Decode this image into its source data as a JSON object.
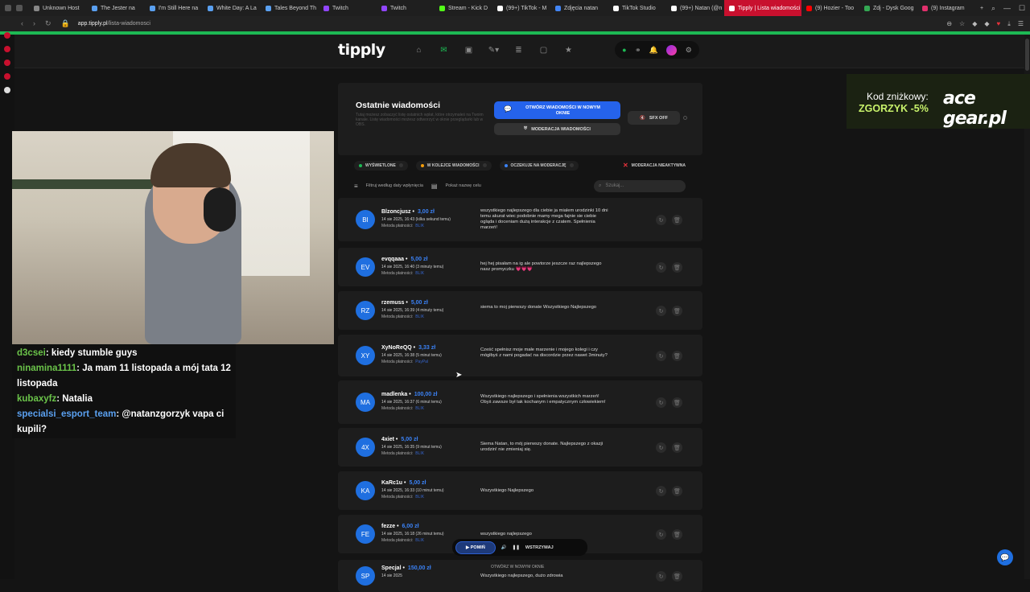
{
  "browser": {
    "tabs": [
      {
        "label": "Unknown Host",
        "color": "#888"
      },
      {
        "label": "The Jester na",
        "color": "#5aa0f0"
      },
      {
        "label": "I'm Still Here na",
        "color": "#5aa0f0"
      },
      {
        "label": "White Day: A La",
        "color": "#5aa0f0"
      },
      {
        "label": "Tales Beyond Th",
        "color": "#5aa0f0"
      },
      {
        "label": "Twitch",
        "color": "#9146ff"
      },
      {
        "label": "Twitch",
        "color": "#9146ff"
      },
      {
        "label": "Stream - Kick D",
        "color": "#53fc18"
      },
      {
        "label": "(99+) TikTok - M",
        "color": "#ffffff"
      },
      {
        "label": "Zdjęcia natan",
        "color": "#4285f4"
      },
      {
        "label": "TikTok Studio",
        "color": "#ffffff"
      },
      {
        "label": "(99+) Natan (@n",
        "color": "#ffffff"
      }
    ],
    "active_tab": "Tipply | Lista wiadomości",
    "tabs_after": [
      {
        "label": "(9) Hozier - Too",
        "color": "#ff0000"
      },
      {
        "label": "Zdj - Dysk Goog",
        "color": "#34a853"
      },
      {
        "label": "(9) Instagram",
        "color": "#e1306c"
      }
    ],
    "url_host": "app.tipply.pl",
    "url_path": "/lista-wiadomosci"
  },
  "header": {
    "logo": "tipply"
  },
  "panel": {
    "title": "Ostatnie wiadomości",
    "description": "Tutaj możesz zobaczyć listę ostatnich wpłat, które otrzymałeś na Twoim kanale. Listę wiadomości możesz odtworzyć w oknie przeglądarki lub w OBS.",
    "open_button": "OTWÓRZ WIADOMOŚCI W NOWYM OKNIE",
    "moderation_button": "MODERACJA WIADOMOŚCI",
    "sfx_button": "SFX OFF"
  },
  "filters": {
    "shown": "WYŚWIETLONE",
    "queue": "W KOLEJCE WIADOMOŚCI",
    "moderation": "OCZEKUJE NA MODERACJĘ",
    "mod_inactive": "MODERACJA NIEAKTYWNA"
  },
  "sort": {
    "by_date": "Filtruj według daty wpłynięcia",
    "show_goal": "Pokaż nazwę celu",
    "search_placeholder": "Szukaj..."
  },
  "messages": [
    {
      "initials": "BI",
      "name": "Blzoncjusz",
      "amount": "3,00 zł",
      "date": "14 sie 2025, 16:43 (kilka sekund temu)",
      "method_label": "Metoda płatności:",
      "method": "BLIK",
      "text": "wszystkiego najlepszego dla ciebie ja mialem urodzinki 10 dni temu akurat wiec podobnie mamy mega fajnie sie ciebie ogląda i doceniam dużą interakcje z czatem. Spełnienia marzeń!"
    },
    {
      "initials": "EV",
      "name": "evqqaaa",
      "amount": "5,00 zł",
      "date": "14 sie 2025, 16:40 (3 minuty temu)",
      "method_label": "Metoda płatności:",
      "method": "BLIK",
      "text": "hej hej pisałam na ig ale powtorze jeszcze raz najlepszego nasz promyczku 💗💗💗"
    },
    {
      "initials": "RZ",
      "name": "rzemuss",
      "amount": "5,00 zł",
      "date": "14 sie 2025, 16:39 (4 minuty temu)",
      "method_label": "Metoda płatności:",
      "method": "BLIK",
      "text": "siema to moj pierwszy donate Wszystkiego Najlepszego"
    },
    {
      "initials": "XY",
      "name": "XyNoReQQ",
      "amount": "3,33 zł",
      "date": "14 sie 2025, 16:38 (5 minut temu)",
      "method_label": "Metoda płatności:",
      "method": "PayPal",
      "text": "Cześć spełnisz moje małe marzenie i mojego kolegi i czy mógłbyś z nami pogadać na discordzie przez nawet 3minuty?"
    },
    {
      "initials": "MA",
      "name": "madlenka",
      "amount": "100,00 zł",
      "date": "14 sie 2025, 16:37 (6 minut temu)",
      "method_label": "Metoda płatności:",
      "method": "BLIK",
      "text": "Wszystkiego najlepszego i spełnienia wszystkich marzeń! Obyś zawsze był tak kochanym i empatycznym człowiekiem!"
    },
    {
      "initials": "4X",
      "name": "4xiet",
      "amount": "5,00 zł",
      "date": "14 sie 2025, 16:35 (9 minut temu)",
      "method_label": "Metoda płatności:",
      "method": "BLIK",
      "text": "Siema Natan, to mój pierwszy donate. Najlepszego z okazji urodzin! nie zmieniaj się."
    },
    {
      "initials": "KA",
      "name": "KaRc1u",
      "amount": "5,00 zł",
      "date": "14 sie 2025, 16:33 (10 minut temu)",
      "method_label": "Metoda płatności:",
      "method": "BLIK",
      "text": "Wszystkiego Najlepszego"
    },
    {
      "initials": "FE",
      "name": "fezze",
      "amount": "6,00 zł",
      "date": "14 sie 2025, 16:18 (26 minut temu)",
      "method_label": "Metoda płatności:",
      "method": "BLIK",
      "text": "wszystkiego najlepszego"
    },
    {
      "initials": "SP",
      "name": "Specjal",
      "amount": "150,00 zł",
      "date": "14 sie 2025",
      "method_label": "",
      "method": "",
      "text": "Wszystkiego najlepszego, dużo zdrowia"
    }
  ],
  "ad": {
    "code_label": "Kod zniżkowy:",
    "code": "ZGORZYK -5%",
    "brand": "ace gear.pl"
  },
  "chat": [
    {
      "user": "d3csei",
      "text": "kiedy stumble guys",
      "color": "#6bc44a"
    },
    {
      "user": "ninamina1111",
      "text": "Ja mam 11 listopada a mój tata 12 listopada",
      "color": "#6bc44a"
    },
    {
      "user": "kubaxyfz",
      "text": "Natalia",
      "color": "#6bc44a"
    },
    {
      "user": "specialsi_esport_team",
      "text": "@natanzgorzyk vapa ci kupili?",
      "color": "#5aa0f0"
    }
  ],
  "player": {
    "skip": "POMIŃ",
    "pause": "WSTRZYMAJ",
    "new_window": "OTWÓRZ W NOWYM OKNIE"
  },
  "colors": {
    "accent_green": "#1db954",
    "accent_blue": "#2563eb",
    "active_tab": "#c8102e"
  }
}
